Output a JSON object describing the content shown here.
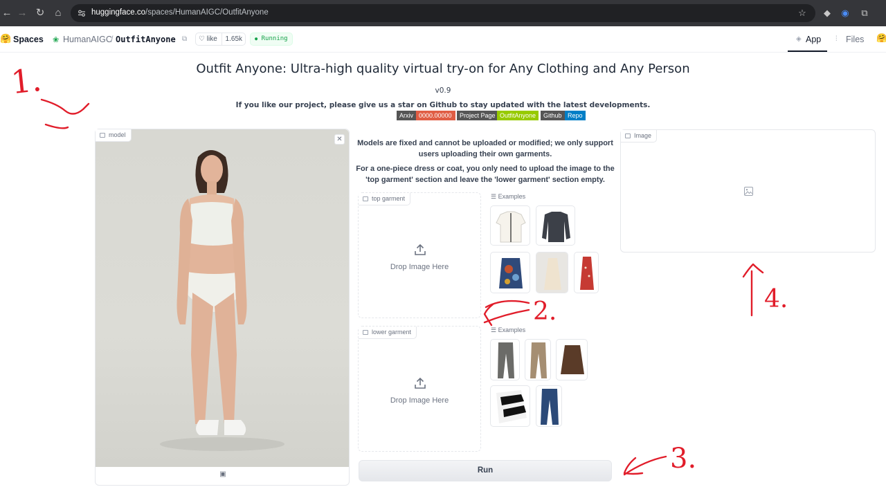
{
  "browser": {
    "url_host": "huggingface.co",
    "url_path": "/spaces/HumanAIGC/OutfitAnyone"
  },
  "hf_header": {
    "spaces_label": "Spaces",
    "org": "HumanAIGC",
    "separator": "/",
    "repo": "OutfitAnyone",
    "like_label": "like",
    "like_count": "1.65k",
    "status": "Running",
    "tabs": [
      {
        "label": "App",
        "active": true
      },
      {
        "label": "Files",
        "active": false
      }
    ]
  },
  "main": {
    "title": "Outfit Anyone: Ultra-high quality virtual try-on for Any Clothing and Any Person",
    "version": "v0.9",
    "star_note": "If you like our project, please give us a star on Github to stay updated with the latest developments.",
    "badges": {
      "arxiv_label": "Arxiv",
      "arxiv_value": "0000.00000",
      "project_label": "Project Page",
      "project_value": "OutfitAnyone",
      "github_label": "Github",
      "github_value": "Repo"
    },
    "model_panel_label": "model",
    "notice_1": "Models are fixed and cannot be uploaded or modified; we only support users uploading their own garments.",
    "notice_2": "For a one-piece dress or coat, you only need to upload the image to the 'top garment' section and leave the 'lower garment' section empty.",
    "top_garment_label": "top garment",
    "lower_garment_label": "lower garment",
    "drop_text": "Drop Image Here",
    "examples_label": "Examples",
    "output_label": "Image",
    "run_label": "Run"
  },
  "annotations": [
    "1.",
    "2.",
    "3.",
    "4."
  ],
  "colors": {
    "arxiv": "#e05d44",
    "project": "#97ca00",
    "github": "#007ec6",
    "badge_label": "#555555",
    "running": "#16a34a",
    "annotation": "#e11d2a"
  }
}
